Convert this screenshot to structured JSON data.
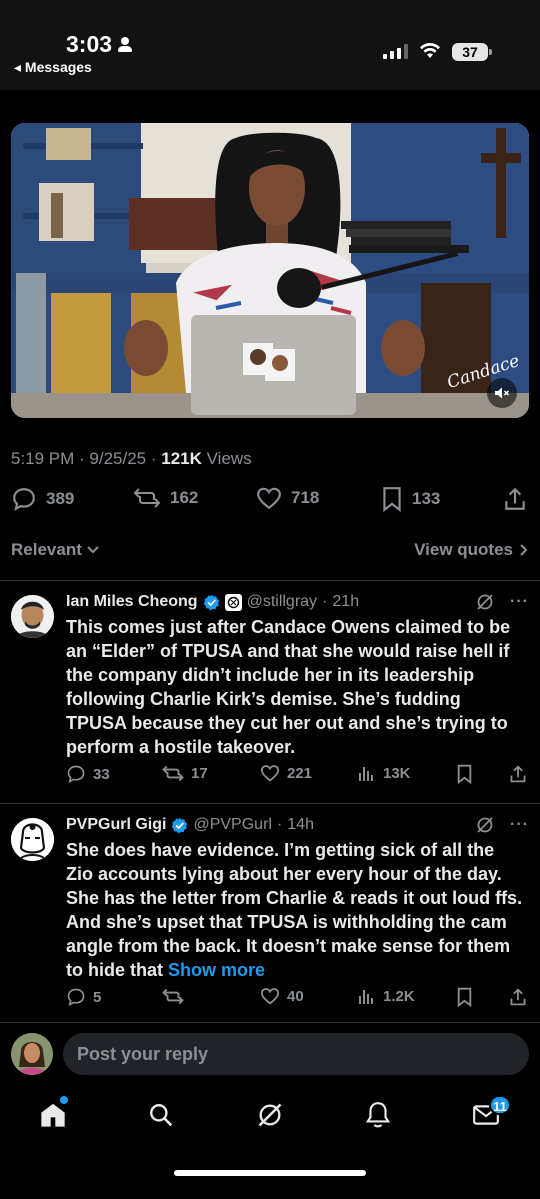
{
  "status_bar": {
    "time": "3:03",
    "back_label": "◂ Messages",
    "battery": "37"
  },
  "video": {
    "signature": "Candace",
    "mute_icon": "speaker-muted-icon"
  },
  "post": {
    "time": "5:19 PM",
    "date": "9/25/25",
    "views_count": "121K",
    "views_label": "Views",
    "replies": "389",
    "reposts": "162",
    "likes": "718",
    "bookmarks": "133"
  },
  "sort": {
    "label": "Relevant",
    "view_quotes": "View quotes"
  },
  "replies": [
    {
      "name": "Ian Miles Cheong",
      "handle": "@stillgray",
      "age": "21h",
      "text": "This comes just after Candace Owens claimed to be an “Elder” of TPUSA and that she would raise hell if the company didn’t include her in its leadership following Charlie Kirk’s demise. She’s fudding TPUSA because they cut her out and she’s trying to perform a hostile takeover.",
      "replies": "33",
      "reposts": "17",
      "likes": "221",
      "views": "13K"
    },
    {
      "name": "PVPGurl Gigi",
      "handle": "@PVPGurl",
      "age": "14h",
      "text": "She does have evidence. I’m getting sick of all the Zio accounts lying about her every hour of the day. She has the letter from Charlie & reads it out loud ffs. And she’s upset that TPUSA is withholding the cam angle from the back. It doesn’t make sense for them to hide that",
      "show_more": "Show more",
      "replies": "5",
      "reposts": "",
      "likes": "40",
      "views": "1.2K"
    }
  ],
  "composer": {
    "placeholder": "Post your reply"
  },
  "tabbar": {
    "messages_badge": "11"
  },
  "colors": {
    "accent": "#1d9bf0",
    "muted": "#8b8f94",
    "background": "#000000"
  }
}
